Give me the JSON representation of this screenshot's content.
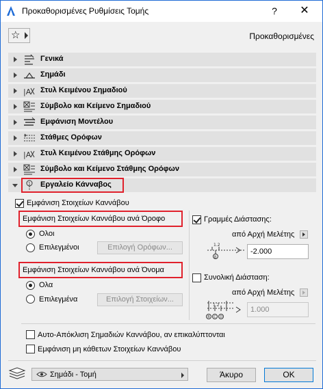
{
  "window": {
    "title": "Προκαθορισμένες Ρυθμίσεις Τομής",
    "help_label": "?",
    "close_label": "✕"
  },
  "header": {
    "favorites_icon": "star-icon",
    "preset_label": "Προκαθορισμένες"
  },
  "panels": [
    {
      "label": "Γενικά",
      "icon": "general-settings-icon",
      "expanded": false
    },
    {
      "label": "Σημάδι",
      "icon": "marker-icon",
      "expanded": false
    },
    {
      "label": "Στυλ Κειμένου Σημαδιού",
      "icon": "text-style-icon",
      "expanded": false
    },
    {
      "label": "Σύμβολο και Κείμενο Σημαδιού",
      "icon": "symbol-text-icon",
      "expanded": false
    },
    {
      "label": "Εμφάνιση Μοντέλου",
      "icon": "model-display-icon",
      "expanded": false
    },
    {
      "label": "Στάθμες Ορόφων",
      "icon": "story-levels-icon",
      "expanded": false
    },
    {
      "label": "Στυλ Κειμένου Στάθμης Ορόφων",
      "icon": "text-style-icon",
      "expanded": false
    },
    {
      "label": "Σύμβολο και Κείμενο Στάθμης Ορόφων",
      "icon": "symbol-text-icon",
      "expanded": false
    },
    {
      "label": "Εργαλείο Κάνναβος",
      "icon": "grid-tool-icon",
      "expanded": true
    }
  ],
  "grid_panel": {
    "show_grid_elements": {
      "label": "Εμφάνιση Στοιχείων Καννάβου",
      "checked": true
    },
    "by_story": {
      "header": "Εμφάνιση Στοιχείων Καννάβου ανά Όροφο",
      "option_all": {
        "label": "Ολοι",
        "selected": true
      },
      "option_selected": {
        "label": "Επιλεγμένοι",
        "selected": false
      },
      "button": "Επιλογή Ορόφων..."
    },
    "by_name": {
      "header": "Εμφάνιση Στοιχείων Καννάβου ανά Όνομα",
      "option_all": {
        "label": "Ολα",
        "selected": true
      },
      "option_selected": {
        "label": "Επιλεγμένα",
        "selected": false
      },
      "button": "Επιλογή Στοιχείων..."
    },
    "dimension_lines": {
      "label": "Γραμμές Διάστασης:",
      "checked": true,
      "origin_label": "από Αρχή Μελέτης",
      "value": "-2.000",
      "diagram_labels": [
        "1.2",
        "B"
      ]
    },
    "total_dimension": {
      "label": "Συνολική Διάσταση:",
      "checked": false,
      "origin_label": "από Αρχή Μελέτης",
      "value": "1.000",
      "diagram_labels": [
        "1.2",
        "B",
        "C",
        "D"
      ]
    },
    "auto_avoid": {
      "label": "Αυτο-Απόκλιση Σημαδιών Καννάβου, αν επικαλύπτονται",
      "checked": false
    },
    "show_non_perpendicular": {
      "label": "Εμφάνιση μη κάθετων Στοιχείων Καννάβου",
      "checked": false
    }
  },
  "footer": {
    "layer_icon": "layers-icon",
    "eye_icon": "eye-icon",
    "layer_value": "Σημάδι - Τομή",
    "cancel_label": "Άκυρο",
    "ok_label": "ΟΚ"
  },
  "colors": {
    "highlight_border": "#e0202b",
    "window_border": "#1e6bd6",
    "ok_border": "#0078d7"
  }
}
